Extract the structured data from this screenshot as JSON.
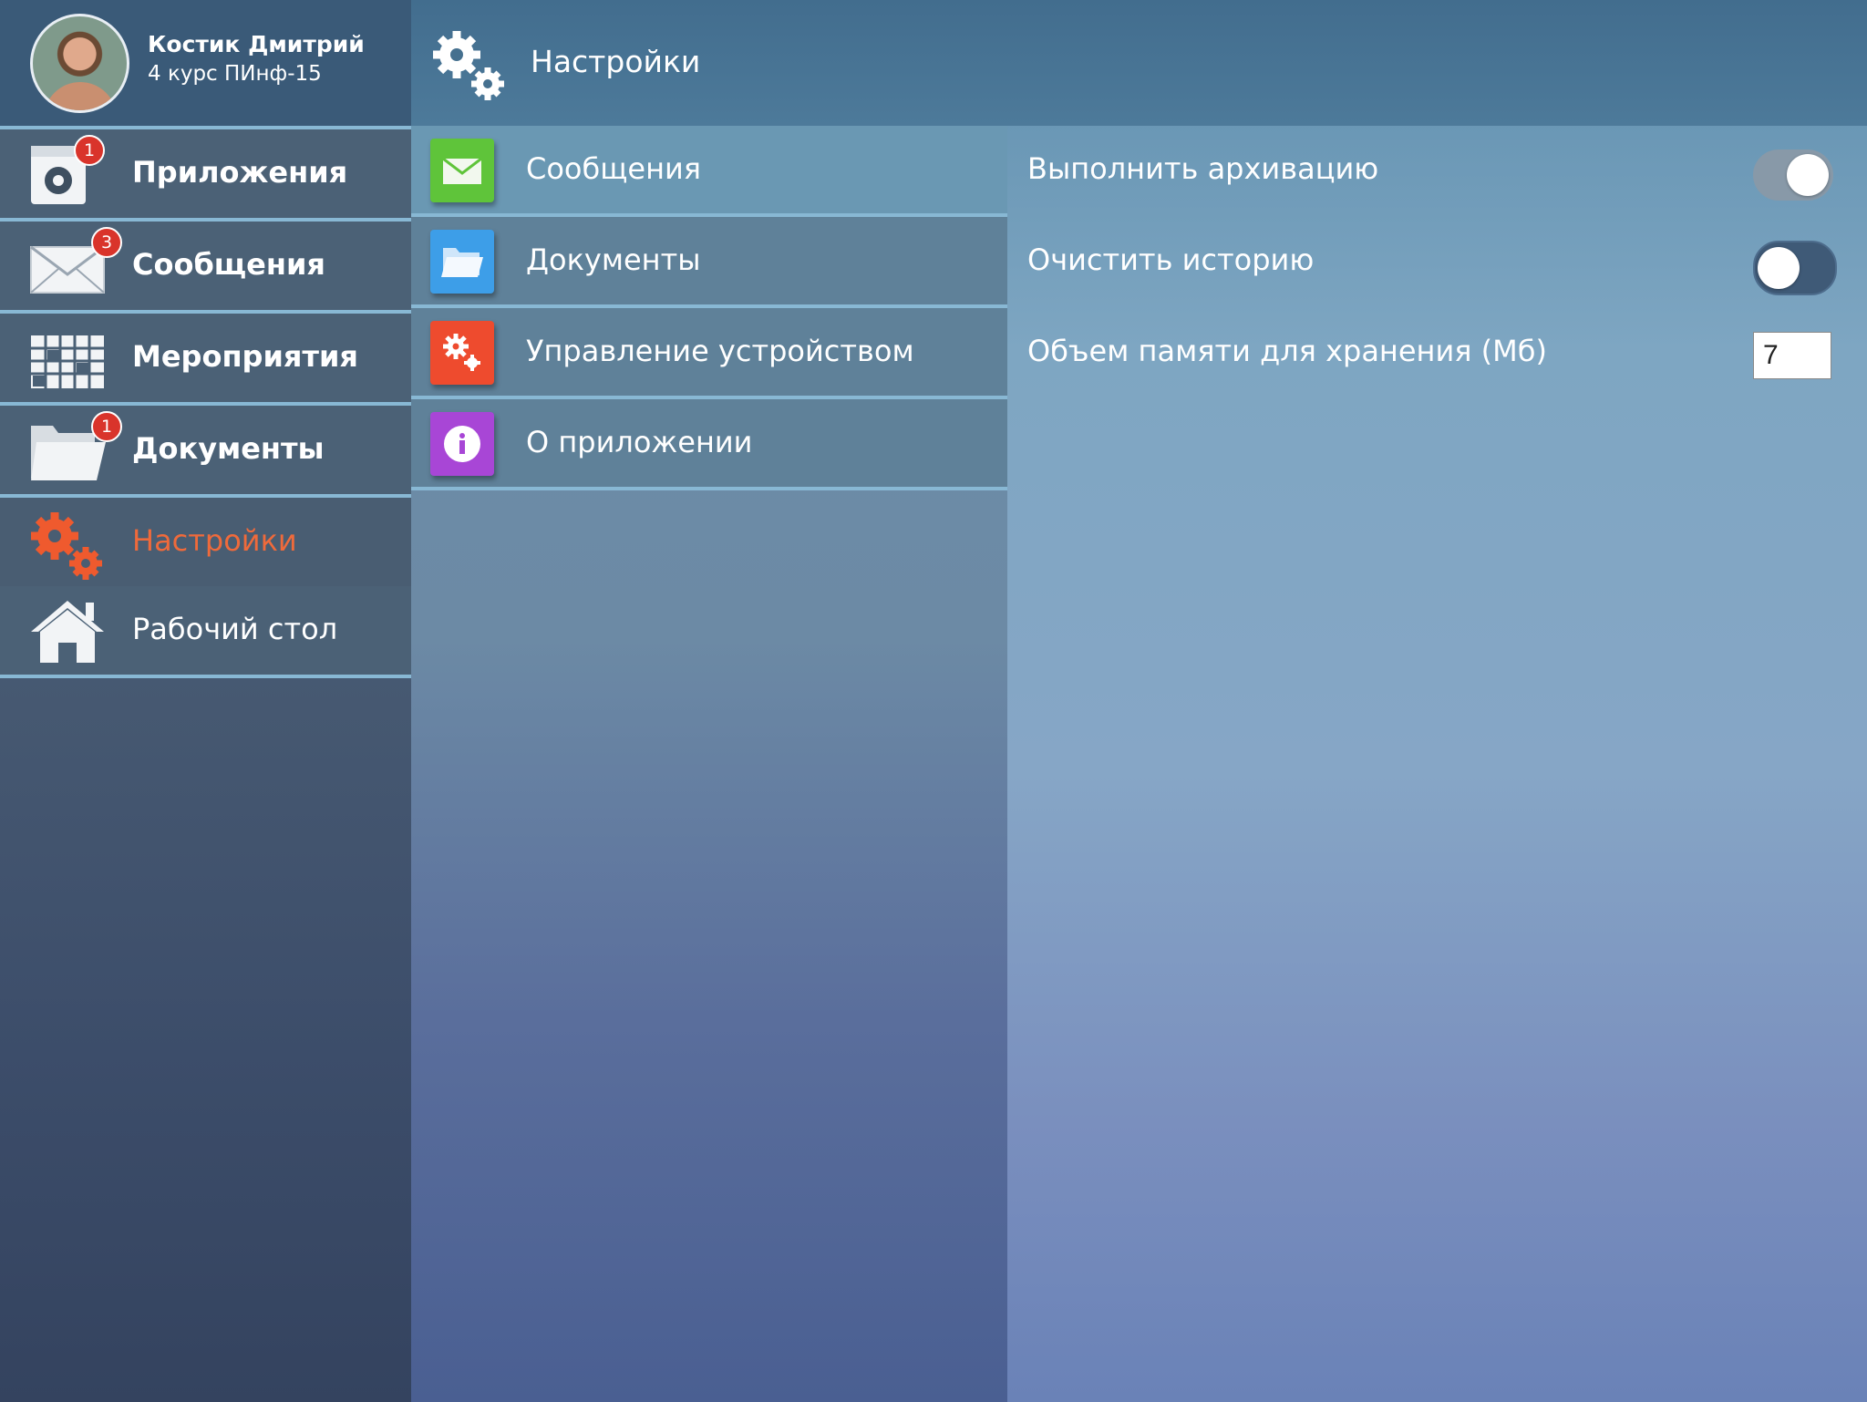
{
  "profile": {
    "name": "Костик Дмитрий",
    "subtitle": "4 курс ПИнф-15"
  },
  "sidebar": {
    "items": [
      {
        "label": "Приложения",
        "icon": "apps-icon",
        "badge": "1"
      },
      {
        "label": "Сообщения",
        "icon": "envelope-icon",
        "badge": "3"
      },
      {
        "label": "Мероприятия",
        "icon": "calendar-icon",
        "badge": ""
      },
      {
        "label": "Документы",
        "icon": "folder-icon",
        "badge": "1"
      },
      {
        "label": "Настройки",
        "icon": "gears-icon",
        "badge": "",
        "active": true
      },
      {
        "label": "Рабочий стол",
        "icon": "home-icon",
        "badge": ""
      }
    ]
  },
  "header": {
    "title": "Настройки",
    "icon": "gears-icon"
  },
  "menu": {
    "items": [
      {
        "label": "Сообщения",
        "icon": "envelope-icon",
        "color": "#5fc43a",
        "selected": true
      },
      {
        "label": "Документы",
        "icon": "folder-icon",
        "color": "#3d9ee8"
      },
      {
        "label": "Управление устройством",
        "icon": "gears-icon",
        "color": "#ee4b2e"
      },
      {
        "label": "О приложении",
        "icon": "info-icon",
        "color": "#a846d6"
      }
    ]
  },
  "settings": {
    "archive": {
      "label": "Выполнить архивацию",
      "enabled": true
    },
    "clear_history": {
      "label": "Очистить историю",
      "enabled": false
    },
    "storage": {
      "label": "Объем памяти для хранения (Мб)",
      "value": "7"
    }
  },
  "colors": {
    "accent_active": "#ef6a3b",
    "badge": "#d9342b",
    "divider": "#88b8d4"
  }
}
